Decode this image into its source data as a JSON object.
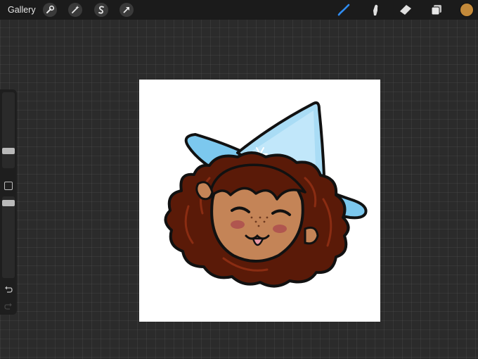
{
  "topbar": {
    "gallery_label": "Gallery",
    "left_tools": [
      {
        "name": "actions",
        "icon": "wrench-icon"
      },
      {
        "name": "adjustments",
        "icon": "magic-wand-icon"
      },
      {
        "name": "selection",
        "icon": "selection-s-icon"
      },
      {
        "name": "transform",
        "icon": "arrow-cursor-icon"
      }
    ],
    "right_tools": [
      {
        "name": "brush",
        "icon": "brush-icon",
        "active": true
      },
      {
        "name": "smudge",
        "icon": "smudge-icon",
        "active": false
      },
      {
        "name": "eraser",
        "icon": "eraser-icon",
        "active": false
      },
      {
        "name": "layers",
        "icon": "layers-icon",
        "active": false
      }
    ],
    "current_color": "#c48a3a"
  },
  "sidebar": {
    "brush_size_level": 0.8,
    "opacity_level": 0.95,
    "controls": [
      "modify-square-icon",
      "undo-icon",
      "redo-icon"
    ]
  },
  "canvas": {
    "artwork": "witch-girl-illustration",
    "background": "#ffffff"
  },
  "colors": {
    "accent": "#2f8cf2",
    "hat": "#7cc8ee",
    "hair": "#5a1a08",
    "skin": "#c48457"
  }
}
